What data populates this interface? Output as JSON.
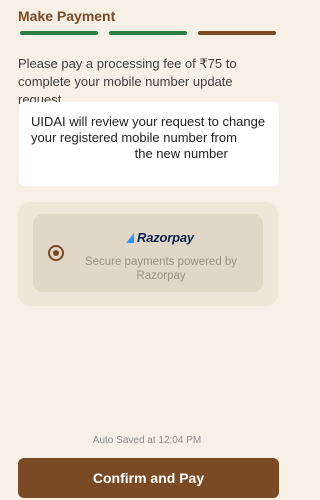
{
  "header": {
    "title": "Make Payment"
  },
  "progress": {
    "steps_total": 3,
    "steps_complete": 3,
    "colors": [
      "#2e7d46",
      "#2e7d46",
      "#7a4a25"
    ]
  },
  "fee_message": "Please pay a processing fee of ₹75 to complete your mobile number update request.",
  "review_box": {
    "line1": "UIDAI will review your request to change",
    "line2": "your registered mobile number from",
    "line3_tail": "the new number"
  },
  "payment_option": {
    "selected": true,
    "brand_name": "Razorpay",
    "description": "Secure payments powered by Razorpay"
  },
  "autosave_text": "Auto Saved at 12:04 PM",
  "confirm_button": {
    "label": "Confirm and Pay",
    "color": "#7a4a25"
  },
  "colors": {
    "brand_brown": "#7a4a25",
    "progress_green": "#2e7d46",
    "background": "#f6f0e6"
  }
}
